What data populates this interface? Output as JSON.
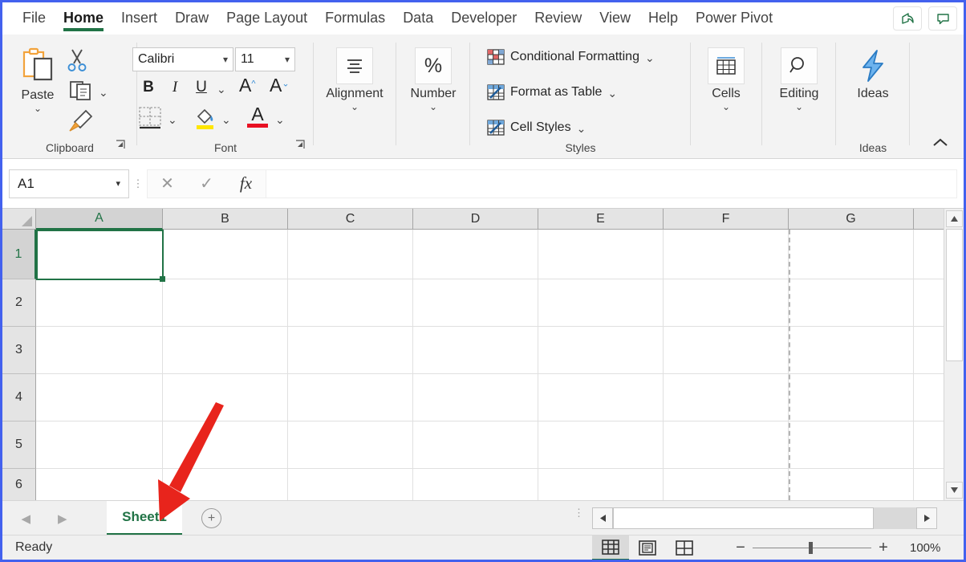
{
  "window": {
    "app": "Microsoft Excel"
  },
  "ribbon_tabs": [
    {
      "label": "File",
      "active": false
    },
    {
      "label": "Home",
      "active": true
    },
    {
      "label": "Insert",
      "active": false
    },
    {
      "label": "Draw",
      "active": false
    },
    {
      "label": "Page Layout",
      "active": false
    },
    {
      "label": "Formulas",
      "active": false
    },
    {
      "label": "Data",
      "active": false
    },
    {
      "label": "Developer",
      "active": false
    },
    {
      "label": "Review",
      "active": false
    },
    {
      "label": "View",
      "active": false
    },
    {
      "label": "Help",
      "active": false
    },
    {
      "label": "Power Pivot",
      "active": false
    }
  ],
  "titlebar_buttons": {
    "share_icon": "share-icon",
    "comments_icon": "comment-icon"
  },
  "ribbon": {
    "collapse_chevron": "⌃",
    "groups": {
      "clipboard": {
        "label": "Clipboard",
        "paste_label": "Paste",
        "paste_chevron": "⌄",
        "cut_icon": "scissors-icon",
        "copy_icon": "copy-icon",
        "copy_chevron": "⌄",
        "format_painter_icon": "format-painter-icon",
        "launcher": "⬌"
      },
      "font": {
        "label": "Font",
        "font_name": "Calibri",
        "font_size": "11",
        "bold": "B",
        "italic": "I",
        "underline": "U",
        "underline_chevron": "⌄",
        "grow_font": "A",
        "shrink_font": "A",
        "borders_chevron": "⌄",
        "fill_chevron": "⌄",
        "font_color_letter": "A",
        "font_color_chevron": "⌄",
        "launcher": "⬌"
      },
      "alignment": {
        "label": "Alignment",
        "chevron": "⌄",
        "icon": "align-icon"
      },
      "number": {
        "label": "Number",
        "chevron": "⌄",
        "symbol": "%"
      },
      "styles": {
        "label": "Styles",
        "items": [
          {
            "label": "Conditional Formatting",
            "chevron": "⌄",
            "icon": "conditional-formatting-icon"
          },
          {
            "label": "Format as Table",
            "chevron": "⌄",
            "icon": "format-as-table-icon"
          },
          {
            "label": "Cell Styles",
            "chevron": "⌄",
            "icon": "cell-styles-icon"
          }
        ]
      },
      "cells": {
        "label": "Cells",
        "chevron": "⌄",
        "icon": "cells-icon"
      },
      "editing": {
        "label": "Editing",
        "chevron": "⌄",
        "icon": "magnifier-icon"
      },
      "ideas": {
        "label": "Ideas",
        "button_label": "Ideas",
        "icon": "lightning-bolt-icon"
      }
    }
  },
  "formula_bar": {
    "name_box_value": "A1",
    "name_box_chevron": "▾",
    "cancel_icon": "✕",
    "enter_icon": "✓",
    "function_icon": "fx",
    "formula_value": "",
    "grip": "⋮"
  },
  "grid": {
    "columns": [
      "A",
      "B",
      "C",
      "D",
      "E",
      "F",
      "G"
    ],
    "rows": [
      "1",
      "2",
      "3",
      "4",
      "5",
      "6"
    ],
    "selected_cell": "A1",
    "selected_column": "A",
    "selected_row": "1",
    "page_break_after_column": "F"
  },
  "sheet_tabs": {
    "prev_arrow": "◀",
    "next_arrow": "▶",
    "tabs": [
      {
        "label": "Sheet1",
        "active": true
      }
    ],
    "add_sheet_label": "+",
    "grip": "⋮"
  },
  "scrollbars": {
    "v_up": "▲",
    "v_down": "▼",
    "h_left": "◀",
    "h_right": "▶"
  },
  "status_bar": {
    "status": "Ready",
    "views": [
      {
        "name": "normal-view",
        "active": true
      },
      {
        "name": "page-layout-view",
        "active": false
      },
      {
        "name": "page-break-preview",
        "active": false
      }
    ],
    "zoom_out": "−",
    "zoom_in": "+",
    "zoom_level": "100%"
  },
  "annotation": {
    "arrow_color": "#e8241c",
    "points_to": "Sheet1"
  },
  "colors": {
    "accent_green": "#217346",
    "window_border": "#4361ee",
    "ribbon_bg": "#f3f3f3"
  }
}
